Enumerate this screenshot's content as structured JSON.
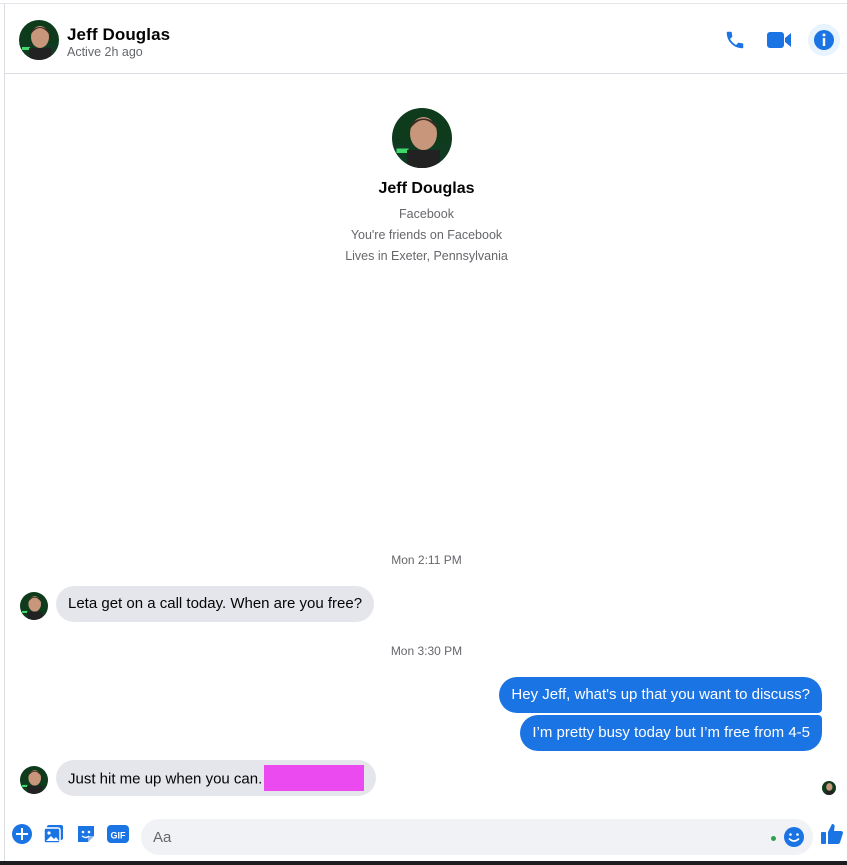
{
  "colors": {
    "accent": "#1b74e4",
    "incoming_bubble": "#e4e6eb",
    "redaction": "#ea4af0",
    "online": "#31a24c"
  },
  "header": {
    "name": "Jeff Douglas",
    "status": "Active 2h ago",
    "icons": [
      "phone-icon",
      "video-icon",
      "info-icon"
    ]
  },
  "intro": {
    "name": "Jeff Douglas",
    "line1": "Facebook",
    "line2": "You're friends on Facebook",
    "line3": "Lives in Exeter, Pennsylvania"
  },
  "conversation": {
    "timestamp1": "Mon 2:11 PM",
    "timestamp2": "Mon 3:30 PM",
    "messages": [
      {
        "from": "contact",
        "text": "Leta get on a call today. When are you free?"
      },
      {
        "from": "me",
        "text": "Hey Jeff, what's up that you want to discuss?"
      },
      {
        "from": "me",
        "text": "I’m pretty busy today but I’m free from 4-5"
      },
      {
        "from": "contact",
        "text": "Just hit me up when you can."
      }
    ]
  },
  "composer": {
    "placeholder": "Aa",
    "icons": [
      "plus-icon",
      "photo-icon",
      "sticker-icon",
      "gif-icon",
      "emoji-icon",
      "thumbs-up-icon"
    ],
    "gif_label": "GIF"
  }
}
